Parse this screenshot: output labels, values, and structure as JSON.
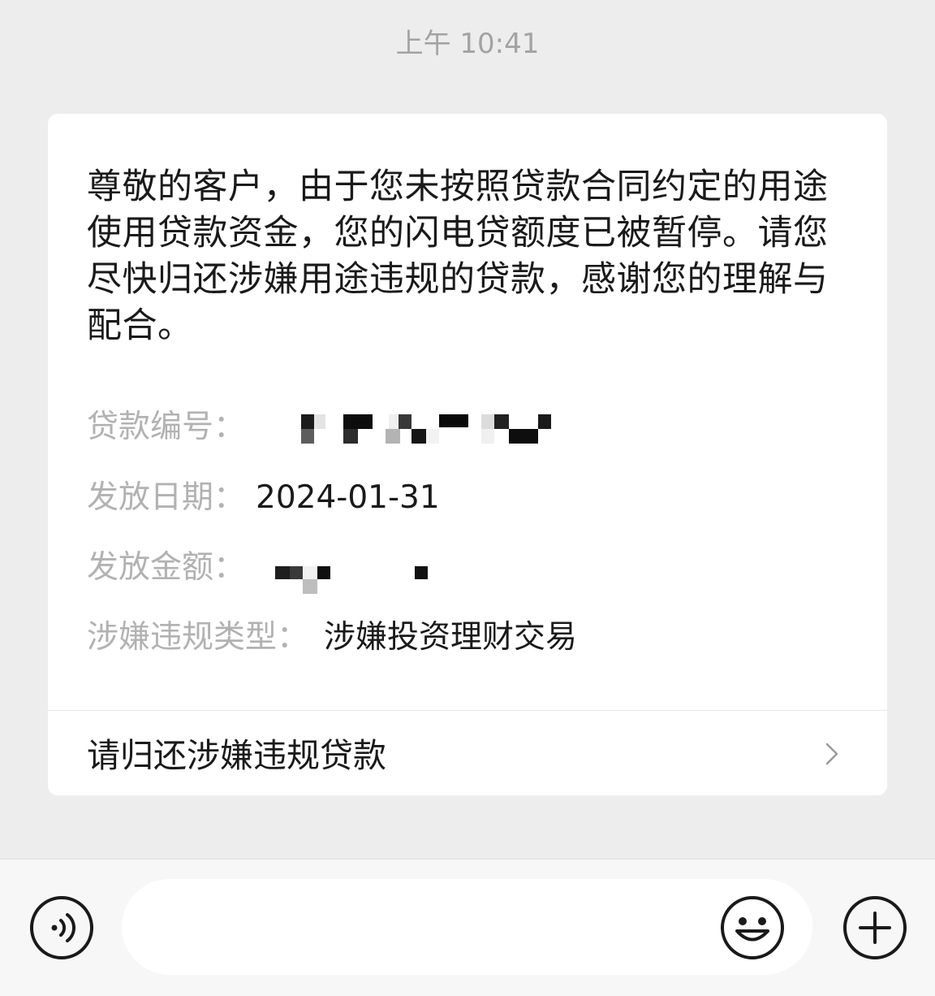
{
  "timestamp": "上午 10:41",
  "message": {
    "body": "尊敬的客户，由于您未按照贷款合同约定的用途使用贷款资金，您的闪电贷额度已被暂停。请您尽快归还涉嫌用途违规的贷款，感谢您的理解与配合。"
  },
  "fields": {
    "loan_id_label": "贷款编号：",
    "issue_date_label": "发放日期：",
    "issue_date_value": "2024-01-31",
    "amount_label": "发放金额：",
    "violation_type_label": "涉嫌违规类型：",
    "violation_type_value": "涉嫌投资理财交易"
  },
  "action": {
    "label": "请归还涉嫌违规贷款",
    "icon": "chevron-right-icon"
  },
  "input_bar": {
    "placeholder": "",
    "voice_icon": "voice-icon",
    "emoji_icon": "emoji-icon",
    "plus_icon": "plus-icon"
  },
  "colors": {
    "background": "#ededed",
    "card": "#ffffff",
    "primary_text": "#1a1a1a",
    "secondary_text": "#b2b2b2"
  }
}
